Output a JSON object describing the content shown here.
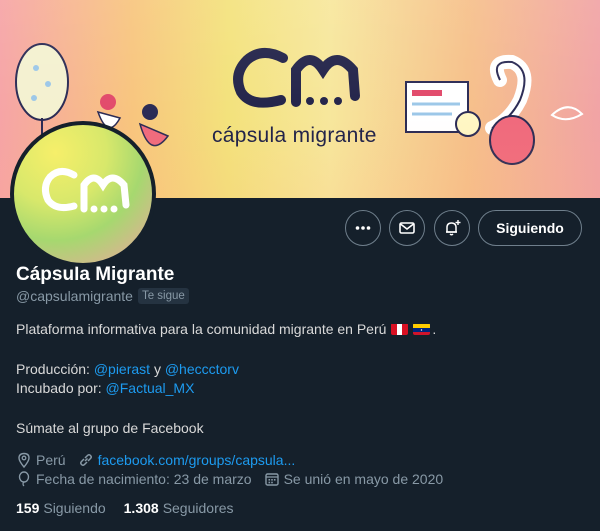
{
  "banner": {
    "logo_text": "CM",
    "caption": "cápsula migrante"
  },
  "profile": {
    "avatar_logo": "CM",
    "name": "Cápsula Migrante",
    "handle": "@capsulamigrante",
    "follows_you": "Te sigue"
  },
  "actions": {
    "more_icon": "more-icon",
    "message_icon": "mail-icon",
    "notify_icon": "bell-plus-icon",
    "follow_label": "Siguiendo"
  },
  "bio": {
    "line1": "Plataforma informativa para la comunidad migrante en Perú",
    "line1_end": ".",
    "prod_label": "Producción:",
    "prod_user1": "@pierast",
    "prod_and": "y",
    "prod_user2": "@heccctorv",
    "incub_label": "Incubado por:",
    "incub_user": "@Factual_MX",
    "cta": "Súmate al grupo de Facebook"
  },
  "meta": {
    "location": "Perú",
    "website": "facebook.com/groups/capsula...",
    "birthday": "Fecha de nacimiento: 23 de marzo",
    "joined": "Se unió en mayo de 2020"
  },
  "stats": {
    "following_count": "159",
    "following_label": "Siguiendo",
    "followers_count": "1.308",
    "followers_label": "Seguidores"
  },
  "colors": {
    "background": "#15202b",
    "link": "#1d9bf0",
    "muted": "#8899a6",
    "logo_navy": "#23244a"
  }
}
